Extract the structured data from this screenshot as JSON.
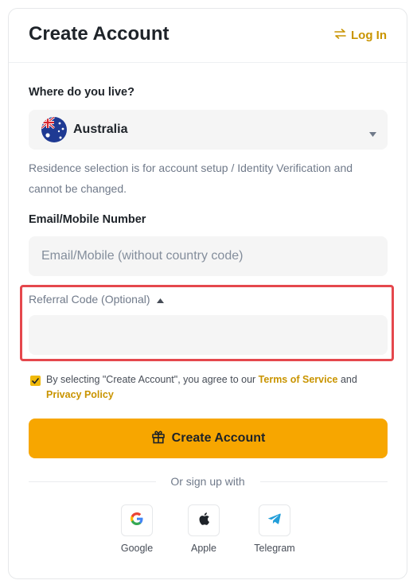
{
  "header": {
    "title": "Create Account",
    "login_label": "Log In"
  },
  "residence": {
    "label": "Where do you live?",
    "selected": "Australia",
    "flag_icon": "australia-flag-icon",
    "help_text": "Residence selection is for account setup / Identity Verification and cannot be changed."
  },
  "contact": {
    "label": "Email/Mobile Number",
    "placeholder": "Email/Mobile (without country code)",
    "value": ""
  },
  "referral": {
    "label": "Referral Code (Optional)",
    "value": ""
  },
  "agreement": {
    "checked": true,
    "prefix": "By selecting \"Create Account\", you agree to our ",
    "terms_link": "Terms of Service",
    "joiner": " and",
    "privacy_link": "Privacy Policy"
  },
  "submit": {
    "label": "Create Account",
    "icon": "gift-icon"
  },
  "social": {
    "divider_text": "Or sign up with",
    "providers": [
      {
        "label": "Google",
        "icon": "google-icon"
      },
      {
        "label": "Apple",
        "icon": "apple-icon"
      },
      {
        "label": "Telegram",
        "icon": "telegram-icon"
      }
    ]
  },
  "colors": {
    "accent": "#f7a600",
    "link": "#c99400",
    "highlight_border": "#e5484d",
    "field_bg": "#f5f5f5"
  }
}
